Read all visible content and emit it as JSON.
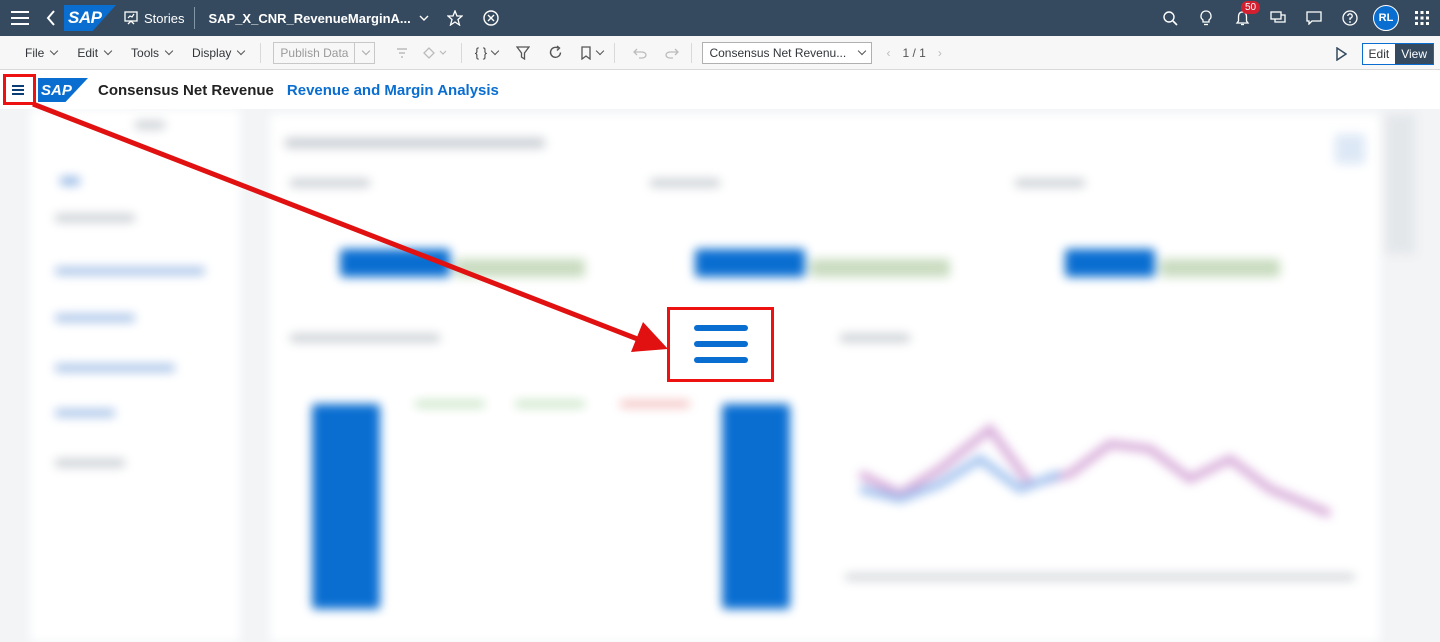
{
  "shell": {
    "stories_label": "Stories",
    "story_title": "SAP_X_CNR_RevenueMarginA...",
    "notification_count": "50",
    "avatar_initials": "RL",
    "logo_text": "SAP"
  },
  "toolbar": {
    "menus": [
      "File",
      "Edit",
      "Tools",
      "Display"
    ],
    "publish_label": "Publish Data",
    "braces_label": "{ }",
    "page_select": "Consensus Net Revenu...",
    "pager": "1 / 1",
    "edit_label": "Edit",
    "view_label": "View"
  },
  "story_header": {
    "logo_text": "SAP",
    "title": "Consensus Net Revenue",
    "subtitle": "Revenue and Margin Analysis"
  },
  "colors": {
    "shell_bg": "#354a5f",
    "accent": "#0a6ed1",
    "annotation": "#e11111",
    "badge": "#d32030"
  }
}
